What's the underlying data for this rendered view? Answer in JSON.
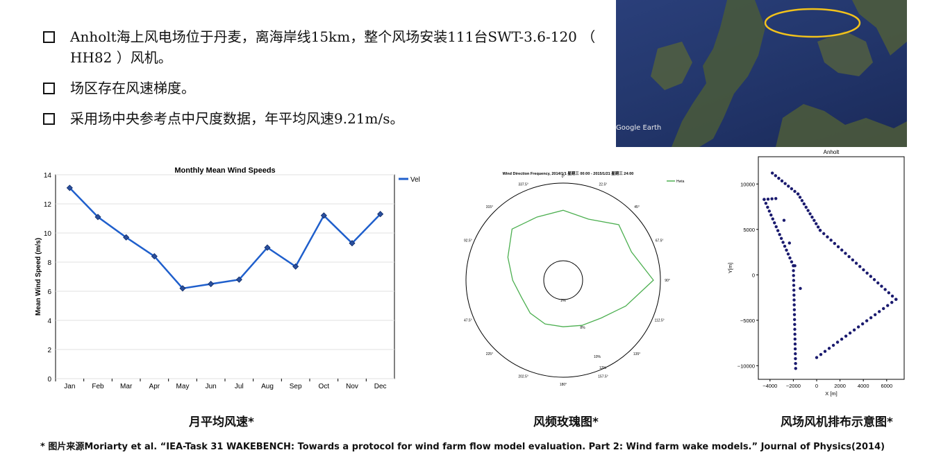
{
  "bullets": [
    {
      "text": "Anholt海上风电场位于丹麦，离海岸线15km，整个风场安装111台SWT-3.6-120 （ HH82 ）风机。"
    },
    {
      "text": "场区存在风速梯度。"
    },
    {
      "text": "采用场中央参考点中尺度数据，年平均风速9.21m/s。"
    }
  ],
  "map": {
    "label": "Google Earth"
  },
  "captions": {
    "monthly": "月平均风速*",
    "rose": "风频玫瑰图*",
    "layout": "风场风机排布示意图*"
  },
  "source": "* 图片来源Moriarty et al. “IEA-Task 31 WAKEBENCH: Towards a protocol for wind farm flow model evaluation. Part 2: Wind farm wake models.” Journal of Physics(2014)",
  "chart_data": [
    {
      "type": "line",
      "title": "Monthly Mean Wind Speeds",
      "xlabel": "",
      "ylabel": "Mean Wind Speed (m/s)",
      "categories": [
        "Jan",
        "Feb",
        "Mar",
        "Apr",
        "May",
        "Jun",
        "Jul",
        "Aug",
        "Sep",
        "Oct",
        "Nov",
        "Dec"
      ],
      "series": [
        {
          "name": "Vel",
          "values": [
            13.1,
            11.1,
            9.7,
            8.4,
            6.2,
            6.5,
            6.8,
            9.0,
            7.7,
            11.2,
            9.3,
            11.3
          ]
        }
      ],
      "ylim": [
        0,
        14
      ],
      "yticks": [
        "0",
        "2",
        "4",
        "6",
        "8",
        "10",
        "12",
        "14"
      ],
      "grid": true,
      "legend": "top-right",
      "color": "#1f5fcc"
    },
    {
      "type": "radar",
      "title": "Wind Direction Frequency, 2014/1/1 星期三 00:00 - 2015/1/21 星期三 24:00",
      "series": [
        {
          "name": "Hwta",
          "values": [
            6.5,
            6.0,
            7.6,
            7.0,
            9.1,
            6.2,
            4.4,
            3.8,
            3.5,
            3.6,
            3.5,
            3.3,
            4.0,
            5.2,
            6.8,
            6.3
          ]
        }
      ],
      "directions": [
        "0°",
        "22.5°",
        "45°",
        "67.5°",
        "90°",
        "112.5°",
        "135°",
        "157.5°",
        "180°",
        "202.5°",
        "225°",
        "247.5°",
        "270°",
        "292.5°",
        "315°",
        "337.5°"
      ],
      "rings": [
        "2%",
        "8%",
        "10%",
        "12%"
      ],
      "color": "#4caf50"
    },
    {
      "type": "scatter",
      "title": "Anholt",
      "xlabel": "X [m]",
      "ylabel": "Y[m]",
      "xlim": [
        -5000,
        7500
      ],
      "ylim": [
        -11500,
        13000
      ],
      "xticks": [
        "−4000",
        "−2000",
        "0",
        "2000",
        "4000",
        "6000"
      ],
      "yticks": [
        "10000",
        "5000",
        "0",
        "−5000",
        "−10000"
      ],
      "color": "#1a1a6e"
    }
  ]
}
